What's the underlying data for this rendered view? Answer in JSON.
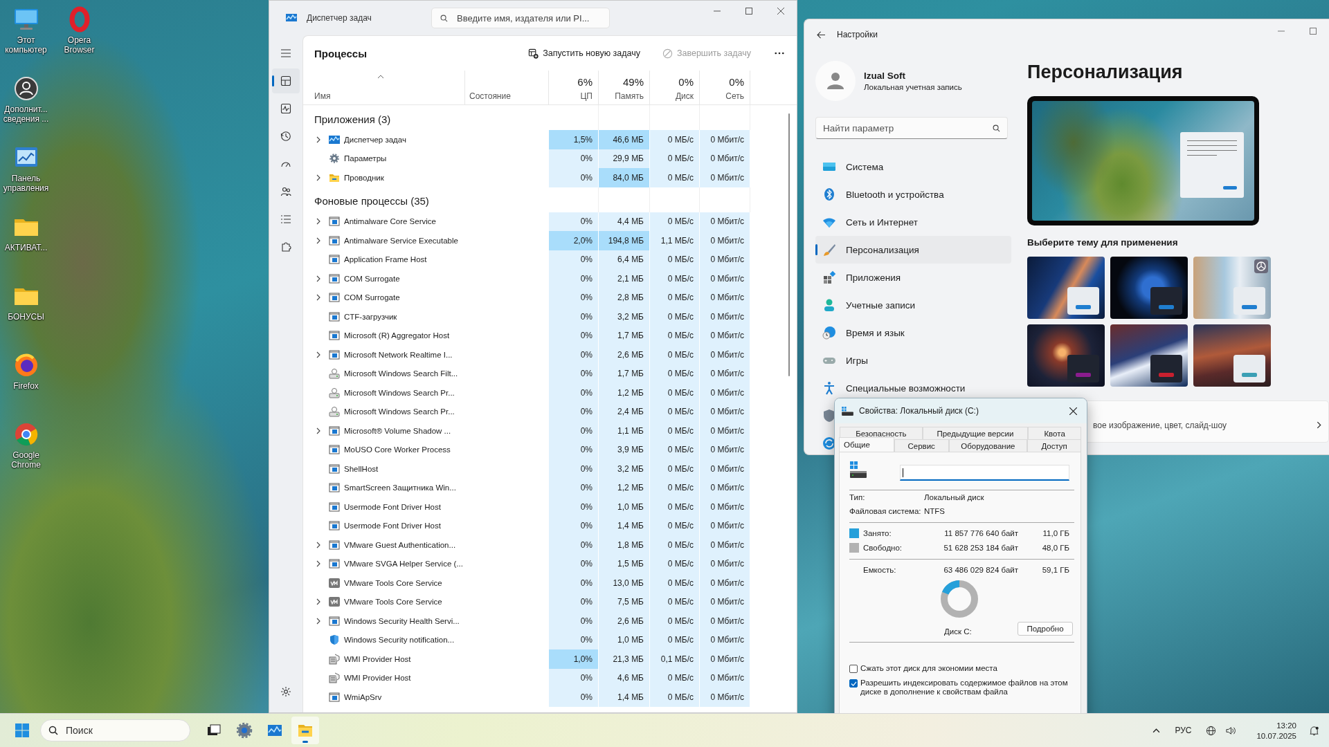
{
  "desktop": {
    "columns": [
      {
        "icons": [
          {
            "label": "Этот компьютер",
            "kind": "pc"
          },
          {
            "label": "Дополнит... сведения ...",
            "kind": "info"
          },
          {
            "label": "Панель управления",
            "kind": "control"
          },
          {
            "label": "АКТИВАТ...",
            "kind": "folder"
          },
          {
            "label": "БОНУСЫ",
            "kind": "folder"
          },
          {
            "label": "Firefox",
            "kind": "firefox"
          },
          {
            "label": "Google Chrome",
            "kind": "chrome"
          }
        ]
      },
      {
        "icons": [
          {
            "label": "Opera Browser",
            "kind": "opera"
          }
        ]
      }
    ]
  },
  "task_manager": {
    "title": "Диспетчер задач",
    "search": {
      "placeholder": "Введите имя, издателя или PI..."
    },
    "nav": [
      {
        "kind": "menu",
        "selected": false
      },
      {
        "kind": "processes",
        "selected": true
      },
      {
        "kind": "performance",
        "selected": false
      },
      {
        "kind": "history",
        "selected": false
      },
      {
        "kind": "startup",
        "selected": false
      },
      {
        "kind": "users",
        "selected": false
      },
      {
        "kind": "details",
        "selected": false
      },
      {
        "kind": "services",
        "selected": false
      },
      {
        "kind": "settings",
        "selected": false
      }
    ],
    "page_title": "Процессы",
    "toolbar": [
      {
        "label": "Запустить новую задачу",
        "kind": "run",
        "disabled": false
      },
      {
        "label": "Завершить задачу",
        "kind": "end",
        "disabled": true
      }
    ],
    "columns": {
      "name": "Имя",
      "status": "Состояние",
      "metrics": [
        {
          "total": "6%",
          "label": "ЦП"
        },
        {
          "total": "49%",
          "label": "Память"
        },
        {
          "total": "0%",
          "label": "Диск"
        },
        {
          "total": "0%",
          "label": "Сеть"
        }
      ]
    },
    "groups": [
      {
        "title": "Приложения (3)",
        "rows": [
          {
            "name": "Диспетчер задач",
            "kind": "taskmgr",
            "expandable": true,
            "cpu": "1,5%",
            "mem": "46,6 МБ",
            "disk": "0 МБ/с",
            "net": "0 Мбит/с",
            "cpu_hot": true,
            "mem_hot": true
          },
          {
            "name": "Параметры",
            "kind": "gear",
            "expandable": false,
            "cpu": "0%",
            "mem": "29,9 МБ",
            "disk": "0 МБ/с",
            "net": "0 Мбит/с",
            "cpu_hot": false,
            "mem_hot": false
          },
          {
            "name": "Проводник",
            "kind": "folder",
            "expandable": true,
            "cpu": "0%",
            "mem": "84,0 МБ",
            "disk": "0 МБ/с",
            "net": "0 Мбит/с",
            "cpu_hot": false,
            "mem_hot": true
          }
        ]
      },
      {
        "title": "Фоновые процессы (35)",
        "rows": [
          {
            "name": "Antimalware Core Service",
            "kind": "app",
            "expandable": true,
            "cpu": "0%",
            "mem": "4,4 МБ",
            "disk": "0 МБ/с",
            "net": "0 Мбит/с",
            "cpu_hot": false,
            "mem_hot": false
          },
          {
            "name": "Antimalware Service Executable",
            "kind": "app",
            "expandable": true,
            "cpu": "2,0%",
            "mem": "194,8 МБ",
            "disk": "1,1 МБ/с",
            "net": "0 Мбит/с",
            "cpu_hot": true,
            "mem_hot": true
          },
          {
            "name": "Application Frame Host",
            "kind": "app",
            "expandable": false,
            "cpu": "0%",
            "mem": "6,4 МБ",
            "disk": "0 МБ/с",
            "net": "0 Мбит/с",
            "cpu_hot": false,
            "mem_hot": false
          },
          {
            "name": "COM Surrogate",
            "kind": "app",
            "expandable": true,
            "cpu": "0%",
            "mem": "2,1 МБ",
            "disk": "0 МБ/с",
            "net": "0 Мбит/с",
            "cpu_hot": false,
            "mem_hot": false
          },
          {
            "name": "COM Surrogate",
            "kind": "app",
            "expandable": true,
            "cpu": "0%",
            "mem": "2,8 МБ",
            "disk": "0 МБ/с",
            "net": "0 Мбит/с",
            "cpu_hot": false,
            "mem_hot": false
          },
          {
            "name": "CTF-загрузчик",
            "kind": "app",
            "expandable": false,
            "cpu": "0%",
            "mem": "3,2 МБ",
            "disk": "0 МБ/с",
            "net": "0 Мбит/с",
            "cpu_hot": false,
            "mem_hot": false
          },
          {
            "name": "Microsoft (R) Aggregator Host",
            "kind": "app",
            "expandable": false,
            "cpu": "0%",
            "mem": "1,7 МБ",
            "disk": "0 МБ/с",
            "net": "0 Мбит/с",
            "cpu_hot": false,
            "mem_hot": false
          },
          {
            "name": "Microsoft Network Realtime I...",
            "kind": "app",
            "expandable": true,
            "cpu": "0%",
            "mem": "2,6 МБ",
            "disk": "0 МБ/с",
            "net": "0 Мбит/с",
            "cpu_hot": false,
            "mem_hot": false
          },
          {
            "name": "Microsoft Windows Search Filt...",
            "kind": "search",
            "expandable": false,
            "cpu": "0%",
            "mem": "1,7 МБ",
            "disk": "0 МБ/с",
            "net": "0 Мбит/с",
            "cpu_hot": false,
            "mem_hot": false
          },
          {
            "name": "Microsoft Windows Search Pr...",
            "kind": "search",
            "expandable": false,
            "cpu": "0%",
            "mem": "1,2 МБ",
            "disk": "0 МБ/с",
            "net": "0 Мбит/с",
            "cpu_hot": false,
            "mem_hot": false
          },
          {
            "name": "Microsoft Windows Search Pr...",
            "kind": "search",
            "expandable": false,
            "cpu": "0%",
            "mem": "2,4 МБ",
            "disk": "0 МБ/с",
            "net": "0 Мбит/с",
            "cpu_hot": false,
            "mem_hot": false
          },
          {
            "name": "Microsoft® Volume Shadow ...",
            "kind": "app",
            "expandable": true,
            "cpu": "0%",
            "mem": "1,1 МБ",
            "disk": "0 МБ/с",
            "net": "0 Мбит/с",
            "cpu_hot": false,
            "mem_hot": false
          },
          {
            "name": "MoUSO Core Worker Process",
            "kind": "app",
            "expandable": false,
            "cpu": "0%",
            "mem": "3,9 МБ",
            "disk": "0 МБ/с",
            "net": "0 Мбит/с",
            "cpu_hot": false,
            "mem_hot": false
          },
          {
            "name": "ShellHost",
            "kind": "app",
            "expandable": false,
            "cpu": "0%",
            "mem": "3,2 МБ",
            "disk": "0 МБ/с",
            "net": "0 Мбит/с",
            "cpu_hot": false,
            "mem_hot": false
          },
          {
            "name": "SmartScreen Защитника Win...",
            "kind": "app",
            "expandable": false,
            "cpu": "0%",
            "mem": "1,2 МБ",
            "disk": "0 МБ/с",
            "net": "0 Мбит/с",
            "cpu_hot": false,
            "mem_hot": false
          },
          {
            "name": "Usermode Font Driver Host",
            "kind": "app",
            "expandable": false,
            "cpu": "0%",
            "mem": "1,0 МБ",
            "disk": "0 МБ/с",
            "net": "0 Мбит/с",
            "cpu_hot": false,
            "mem_hot": false
          },
          {
            "name": "Usermode Font Driver Host",
            "kind": "app",
            "expandable": false,
            "cpu": "0%",
            "mem": "1,4 МБ",
            "disk": "0 МБ/с",
            "net": "0 Мбит/с",
            "cpu_hot": false,
            "mem_hot": false
          },
          {
            "name": "VMware Guest Authentication...",
            "kind": "app",
            "expandable": true,
            "cpu": "0%",
            "mem": "1,8 МБ",
            "disk": "0 МБ/с",
            "net": "0 Мбит/с",
            "cpu_hot": false,
            "mem_hot": false
          },
          {
            "name": "VMware SVGA Helper Service (...",
            "kind": "app",
            "expandable": true,
            "cpu": "0%",
            "mem": "1,5 МБ",
            "disk": "0 МБ/с",
            "net": "0 Мбит/с",
            "cpu_hot": false,
            "mem_hot": false
          },
          {
            "name": "VMware Tools Core Service",
            "kind": "vm",
            "expandable": false,
            "cpu": "0%",
            "mem": "13,0 МБ",
            "disk": "0 МБ/с",
            "net": "0 Мбит/с",
            "cpu_hot": false,
            "mem_hot": false
          },
          {
            "name": "VMware Tools Core Service",
            "kind": "vm",
            "expandable": true,
            "cpu": "0%",
            "mem": "7,5 МБ",
            "disk": "0 МБ/с",
            "net": "0 Мбит/с",
            "cpu_hot": false,
            "mem_hot": false
          },
          {
            "name": "Windows Security Health Servi...",
            "kind": "app",
            "expandable": true,
            "cpu": "0%",
            "mem": "2,6 МБ",
            "disk": "0 МБ/с",
            "net": "0 Мбит/с",
            "cpu_hot": false,
            "mem_hot": false
          },
          {
            "name": "Windows Security notification...",
            "kind": "shield",
            "expandable": false,
            "cpu": "0%",
            "mem": "1,0 МБ",
            "disk": "0 МБ/с",
            "net": "0 Мбит/с",
            "cpu_hot": false,
            "mem_hot": false
          },
          {
            "name": "WMI Provider Host",
            "kind": "wmi",
            "expandable": false,
            "cpu": "1,0%",
            "mem": "21,3 МБ",
            "disk": "0,1 МБ/с",
            "net": "0 Мбит/с",
            "cpu_hot": true,
            "mem_hot": false
          },
          {
            "name": "WMI Provider Host",
            "kind": "wmi",
            "expandable": false,
            "cpu": "0%",
            "mem": "4,6 МБ",
            "disk": "0 МБ/с",
            "net": "0 Мбит/с",
            "cpu_hot": false,
            "mem_hot": false
          },
          {
            "name": "WmiApSrv",
            "kind": "app",
            "expandable": false,
            "cpu": "0%",
            "mem": "1,4 МБ",
            "disk": "0 МБ/с",
            "net": "0 Мбит/с",
            "cpu_hot": false,
            "mem_hot": false
          }
        ]
      }
    ]
  },
  "settings": {
    "title": "Настройки",
    "user": {
      "name": "Izual Soft",
      "account": "Локальная учетная запись"
    },
    "search": {
      "placeholder": "Найти параметр"
    },
    "nav": [
      {
        "label": "Система",
        "kind": "system",
        "selected": false
      },
      {
        "label": "Bluetooth и устройства",
        "kind": "bluetooth",
        "selected": false
      },
      {
        "label": "Сеть и Интернет",
        "kind": "network",
        "selected": false
      },
      {
        "label": "Персонализация",
        "kind": "brush",
        "selected": true
      },
      {
        "label": "Приложения",
        "kind": "apps",
        "selected": false
      },
      {
        "label": "Учетные записи",
        "kind": "accounts",
        "selected": false
      },
      {
        "label": "Время и язык",
        "kind": "time",
        "selected": false
      },
      {
        "label": "Игры",
        "kind": "games",
        "selected": false
      },
      {
        "label": "Специальные возможности",
        "kind": "accessibility",
        "selected": false
      }
    ],
    "heading": "Персонализация",
    "themes_title": "Выберите тему для применения",
    "themes": [
      {
        "color": "#1f7ed0",
        "dark": false,
        "badge": false
      },
      {
        "color": "#1f7ed0",
        "dark": true,
        "badge": false
      },
      {
        "color": "#1f7ed0",
        "dark": false,
        "badge": true
      },
      {
        "color": "#8a1c8e",
        "dark": true,
        "badge": false
      },
      {
        "color": "#c8202f",
        "dark": true,
        "badge": false
      },
      {
        "color": "#3b9fb5",
        "dark": false,
        "badge": false
      }
    ],
    "card": {
      "text": "вое изображение, цвет, слайд-шоу"
    }
  },
  "disk": {
    "title": "Свойства: Локальный диск (C:)",
    "tabs": [
      [
        {
          "label": "Безопасность",
          "selected": false
        },
        {
          "label": "Предыдущие версии",
          "selected": false
        },
        {
          "label": "Квота",
          "selected": false
        }
      ],
      [
        {
          "label": "Общие",
          "selected": true
        },
        {
          "label": "Сервис",
          "selected": false
        },
        {
          "label": "Оборудование",
          "selected": false
        },
        {
          "label": "Доступ",
          "selected": false
        }
      ]
    ],
    "info": [
      {
        "label": "Тип:",
        "value": "Локальный диск"
      },
      {
        "label": "Файловая система:",
        "value": "NTFS"
      }
    ],
    "usage": [
      {
        "label": "Занято:",
        "bytes": "11 857 776 640 байт",
        "size": "11,0 ГБ",
        "color": "#26a0da"
      },
      {
        "label": "Свободно:",
        "bytes": "51 628 253 184 байт",
        "size": "48,0 ГБ",
        "color": "#b2b2b2"
      }
    ],
    "capacity": {
      "label": "Емкость:",
      "bytes": "63 486 029 824 байт",
      "size": "59,1 ГБ"
    },
    "drive_label": "Диск C:",
    "details_button": "Подробно",
    "options": [
      {
        "label": "Сжать этот диск для экономии места",
        "checked": false
      },
      {
        "label": "Разрешить индексировать содержимое файлов на этом диске в дополнение к свойствам файла",
        "checked": true
      }
    ]
  },
  "taskbar": {
    "search_placeholder": "Поиск",
    "apps": [
      {
        "kind": "taskview",
        "selected": false
      },
      {
        "kind": "settings",
        "selected": false
      },
      {
        "kind": "taskmgr",
        "selected": false
      },
      {
        "kind": "explorer",
        "selected": true
      }
    ],
    "language": "РУС",
    "time": "13:20",
    "date": "10.07.2025"
  }
}
